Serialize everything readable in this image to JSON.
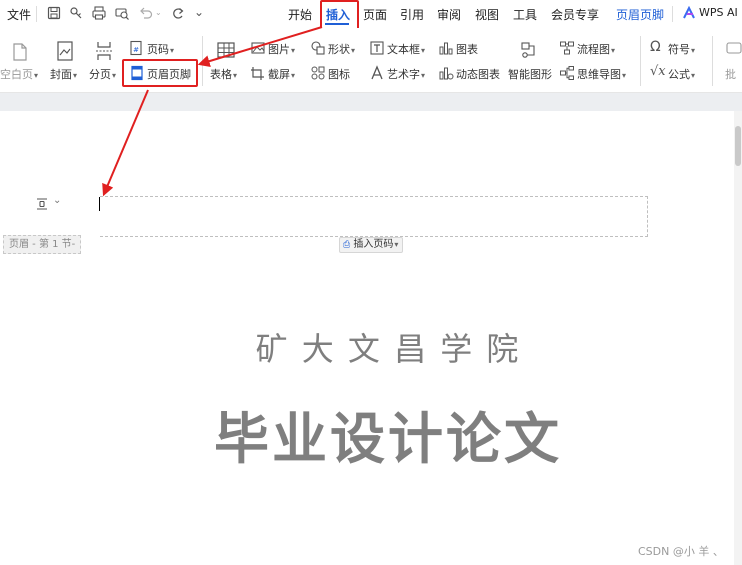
{
  "menu": {
    "file": "文件",
    "tabs": [
      "开始",
      "插入",
      "页面",
      "引用",
      "审阅",
      "视图",
      "工具",
      "会员专享",
      "页眉页脚"
    ],
    "active_tab": "插入",
    "wps_ai": "WPS AI"
  },
  "ribbon": {
    "blank_page": "空白页",
    "cover": "封面",
    "page_break": "分页",
    "page_number": "页码",
    "header_footer": "页眉页脚",
    "table": "表格",
    "picture": "图片",
    "screenshot": "截屏",
    "shape": "形状",
    "icon": "图标",
    "textbox": "文本框",
    "art_text": "艺术字",
    "chart": "图表",
    "dynamic_chart": "动态图表",
    "smart_graphic": "智能图形",
    "flowchart": "流程图",
    "mindmap": "思维导图",
    "symbol": "符号",
    "formula": "公式",
    "comment_partial": "批"
  },
  "document": {
    "header_tag": "页眉 - 第 1 节-",
    "insert_page_number": "插入页码",
    "school": "矿 大 文 昌 学 院",
    "title": "毕业设计论文"
  },
  "watermark": "CSDN @小 羊 、",
  "colors": {
    "accent_blue": "#1f5fd6",
    "highlight_red": "#e02020",
    "title_gray": "#7f7f7f"
  }
}
